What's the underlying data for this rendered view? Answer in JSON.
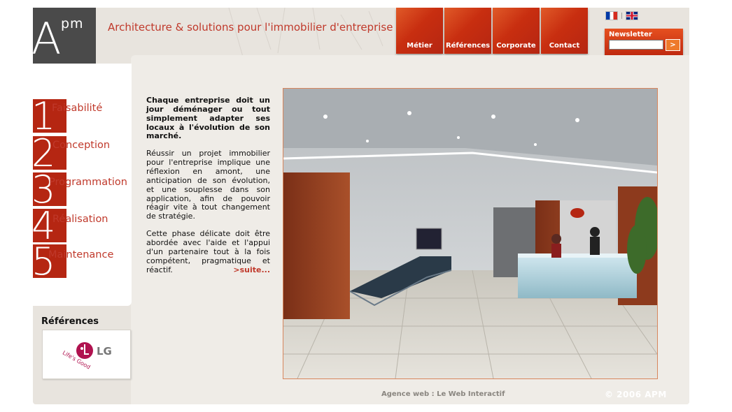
{
  "header": {
    "logo_big": "A",
    "logo_small": "pm",
    "tagline": "Architecture & solutions pour l'immobilier d'entreprise"
  },
  "nav": {
    "items": [
      {
        "label": "Métier"
      },
      {
        "label": "Références"
      },
      {
        "label": "Corporate"
      },
      {
        "label": "Contact"
      }
    ]
  },
  "languages": {
    "fr": "french-flag",
    "en": "uk-flag",
    "separator": "|"
  },
  "newsletter": {
    "label": "Newsletter",
    "placeholder": "",
    "submit": ">"
  },
  "steps": [
    {
      "num": "1",
      "label": "Faisabilité"
    },
    {
      "num": "2",
      "label": "Conception"
    },
    {
      "num": "3",
      "label": "Programmation"
    },
    {
      "num": "4",
      "label": "Réalisation"
    },
    {
      "num": "5",
      "label": "Maintenance"
    }
  ],
  "intro": {
    "lead": "Chaque entreprise doit un jour déménager ou tout simplement adapter ses locaux à l'évolution de son marché.",
    "p1": "Réussir un projet immobilier pour l'entreprise implique une réflexion en amont, une anticipation de son évolution, et une souplesse dans son application, afin de pouvoir réagir vite à tout changement de stratégie.",
    "p2": "Cette phase délicate doit être abordée avec l'aide et l'appui d'un partenaire tout à la fois compétent, pragmatique et réactif.",
    "more": ">suite..."
  },
  "references": {
    "title": "Références",
    "logo_text": "LG",
    "logo_slogan": "Life's Good"
  },
  "footer": {
    "agency": "Agence web : Le Web Interactif",
    "copyright": "© 2006 APM"
  },
  "colors": {
    "accent": "#c0392b",
    "nav_red": "#c82e10",
    "panel": "#efece7"
  }
}
